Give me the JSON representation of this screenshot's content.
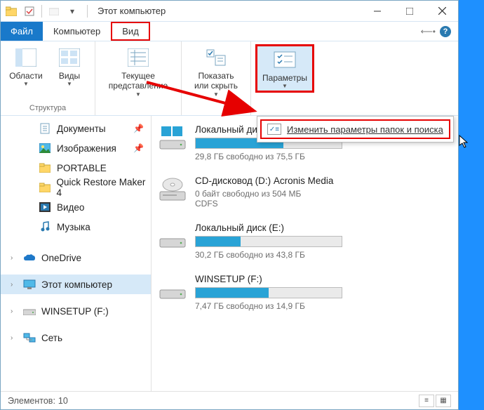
{
  "titlebar": {
    "title": "Этот компьютер"
  },
  "tabs": {
    "file": "Файл",
    "computer": "Компьютер",
    "view": "Вид"
  },
  "ribbon": {
    "areas": {
      "label": "Области",
      "group": "Структура"
    },
    "views": {
      "label": "Виды"
    },
    "currentview": {
      "label": "Текущее\nпредставление"
    },
    "showhide": {
      "label": "Показать\nили скрыть"
    },
    "options": {
      "label": "Параметры"
    },
    "options_menu_item": "Изменить параметры папок и поиска"
  },
  "sidebar": {
    "items": [
      {
        "label": "Документы",
        "icon": "documents",
        "pin": true
      },
      {
        "label": "Изображения",
        "icon": "pictures",
        "pin": true
      },
      {
        "label": "PORTABLE",
        "icon": "folder"
      },
      {
        "label": "Quick Restore Maker 4",
        "icon": "folder"
      },
      {
        "label": "Видео",
        "icon": "video"
      },
      {
        "label": "Музыка",
        "icon": "music"
      }
    ],
    "onedrive": "OneDrive",
    "thispc": "Этот компьютер",
    "winsetup": "WINSETUP (F:)",
    "network": "Сеть"
  },
  "drives": [
    {
      "name": "Локальный диск (C:)",
      "free": "29,8 ГБ свободно из 75,5 ГБ",
      "fill": 60,
      "type": "hdd",
      "bar": true
    },
    {
      "name": "CD-дисковод (D:) Acronis Media",
      "free": "0 байт свободно из 504 МБ",
      "sub": "CDFS",
      "type": "cd",
      "bar": false
    },
    {
      "name": "Локальный диск (E:)",
      "free": "30,2 ГБ свободно из 43,8 ГБ",
      "fill": 31,
      "type": "hdd",
      "bar": true
    },
    {
      "name": "WINSETUP (F:)",
      "free": "7,47 ГБ свободно из 14,9 ГБ",
      "fill": 50,
      "type": "hdd",
      "bar": true
    }
  ],
  "statusbar": {
    "count_label": "Элементов:",
    "count": "10"
  }
}
